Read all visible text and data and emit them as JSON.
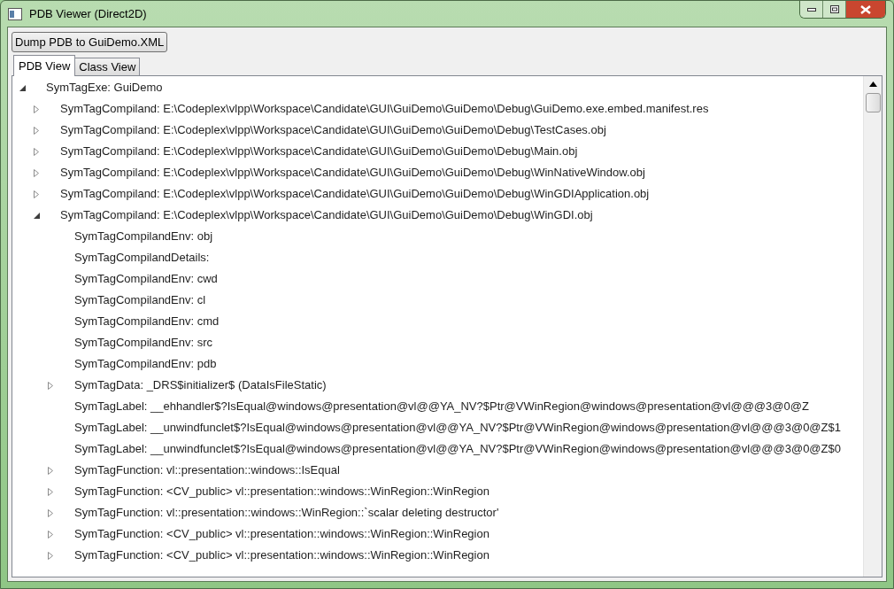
{
  "window": {
    "title": "PDB Viewer (Direct2D)"
  },
  "toolbar": {
    "button": "Dump PDB to GuiDemo.XML"
  },
  "tabs": [
    {
      "label": "PDB View",
      "selected": true
    },
    {
      "label": "Class View",
      "selected": false
    }
  ],
  "tree": [
    {
      "kind": "branch",
      "label": "SymTagExe: GuiDemo",
      "expanded": true,
      "children": [
        {
          "kind": "branch",
          "label": "SymTagCompiland: E:\\Codeplex\\vlpp\\Workspace\\Candidate\\GUI\\GuiDemo\\GuiDemo\\Debug\\GuiDemo.exe.embed.manifest.res",
          "expanded": false
        },
        {
          "kind": "branch",
          "label": "SymTagCompiland: E:\\Codeplex\\vlpp\\Workspace\\Candidate\\GUI\\GuiDemo\\GuiDemo\\Debug\\TestCases.obj",
          "expanded": false
        },
        {
          "kind": "branch",
          "label": "SymTagCompiland: E:\\Codeplex\\vlpp\\Workspace\\Candidate\\GUI\\GuiDemo\\GuiDemo\\Debug\\Main.obj",
          "expanded": false
        },
        {
          "kind": "branch",
          "label": "SymTagCompiland: E:\\Codeplex\\vlpp\\Workspace\\Candidate\\GUI\\GuiDemo\\GuiDemo\\Debug\\WinNativeWindow.obj",
          "expanded": false
        },
        {
          "kind": "branch",
          "label": "SymTagCompiland: E:\\Codeplex\\vlpp\\Workspace\\Candidate\\GUI\\GuiDemo\\GuiDemo\\Debug\\WinGDIApplication.obj",
          "expanded": false
        },
        {
          "kind": "branch",
          "label": "SymTagCompiland: E:\\Codeplex\\vlpp\\Workspace\\Candidate\\GUI\\GuiDemo\\GuiDemo\\Debug\\WinGDI.obj",
          "expanded": true,
          "children": [
            {
              "kind": "leaf",
              "label": "SymTagCompilandEnv: obj"
            },
            {
              "kind": "leaf",
              "label": "SymTagCompilandDetails:"
            },
            {
              "kind": "leaf",
              "label": "SymTagCompilandEnv: cwd"
            },
            {
              "kind": "leaf",
              "label": "SymTagCompilandEnv: cl"
            },
            {
              "kind": "leaf",
              "label": "SymTagCompilandEnv: cmd"
            },
            {
              "kind": "leaf",
              "label": "SymTagCompilandEnv: src"
            },
            {
              "kind": "leaf",
              "label": "SymTagCompilandEnv: pdb"
            },
            {
              "kind": "branch",
              "label": "SymTagData: _DRS$initializer$ (DataIsFileStatic)",
              "expanded": false
            },
            {
              "kind": "leaf",
              "label": "SymTagLabel: __ehhandler$?IsEqual@windows@presentation@vl@@YA_NV?$Ptr@VWinRegion@windows@presentation@vl@@@3@0@Z"
            },
            {
              "kind": "leaf",
              "label": "SymTagLabel: __unwindfunclet$?IsEqual@windows@presentation@vl@@YA_NV?$Ptr@VWinRegion@windows@presentation@vl@@@3@0@Z$1"
            },
            {
              "kind": "leaf",
              "label": "SymTagLabel: __unwindfunclet$?IsEqual@windows@presentation@vl@@YA_NV?$Ptr@VWinRegion@windows@presentation@vl@@@3@0@Z$0"
            },
            {
              "kind": "branch",
              "label": "SymTagFunction: vl::presentation::windows::IsEqual",
              "expanded": false
            },
            {
              "kind": "branch",
              "label": "SymTagFunction: <CV_public> vl::presentation::windows::WinRegion::WinRegion",
              "expanded": false
            },
            {
              "kind": "branch",
              "label": "SymTagFunction: vl::presentation::windows::WinRegion::`scalar deleting destructor'",
              "expanded": false
            },
            {
              "kind": "branch",
              "label": "SymTagFunction: <CV_public> vl::presentation::windows::WinRegion::WinRegion",
              "expanded": false
            },
            {
              "kind": "branch",
              "label": "SymTagFunction: <CV_public> vl::presentation::windows::WinRegion::WinRegion",
              "expanded": false
            }
          ]
        }
      ]
    }
  ]
}
